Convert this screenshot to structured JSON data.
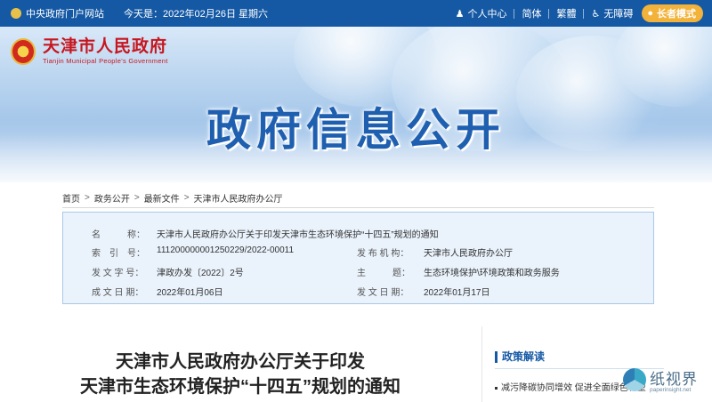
{
  "topbar": {
    "portal_link": "中央政府门户网站",
    "date_text": "今天是：2022年02月26日 星期六",
    "personal_center": "个人中心",
    "simplified": "简体",
    "traditional": "繁體",
    "accessibility": "无障碍",
    "elder_mode": "长者模式"
  },
  "logo": {
    "name_cn": "天津市人民政府",
    "name_en": "Tianjin Municipal People's Government"
  },
  "banner": {
    "title": "政府信息公开"
  },
  "breadcrumb": [
    "首页",
    "政务公开",
    "最新文件",
    "天津市人民政府办公厅"
  ],
  "info": {
    "name_label": "名　　　称：",
    "name_value": "天津市人民政府办公厅关于印发天津市生态环境保护“十四五”规划的通知",
    "index_label": "索　引　号：",
    "index_value": "111200000001250229/2022-00011",
    "issuer_label": "发 布 机 构：",
    "issuer_value": "天津市人民政府办公厅",
    "docno_label": "发 文 字 号：",
    "docno_value": "津政办发〔2022〕2号",
    "topic_label": "主　　　题：",
    "topic_value": "生态环境保护\\环境政策和政务服务",
    "created_label": "成 文 日 期：",
    "created_value": "2022年01月06日",
    "published_label": "发 文 日 期：",
    "published_value": "2022年01月17日"
  },
  "article": {
    "title_line1": "天津市人民政府办公厅关于印发",
    "title_line2": "天津市生态环境保护“十四五”规划的通知"
  },
  "policy": {
    "heading": "政策解读",
    "item1": "减污降碳协同增效 促进全面绿色转型"
  },
  "watermark": {
    "cn": "纸视界",
    "en": "paperinsight.net"
  },
  "colors": {
    "topbar": "#1559a5",
    "accent": "#c7161e",
    "elder": "#f3b23a"
  }
}
